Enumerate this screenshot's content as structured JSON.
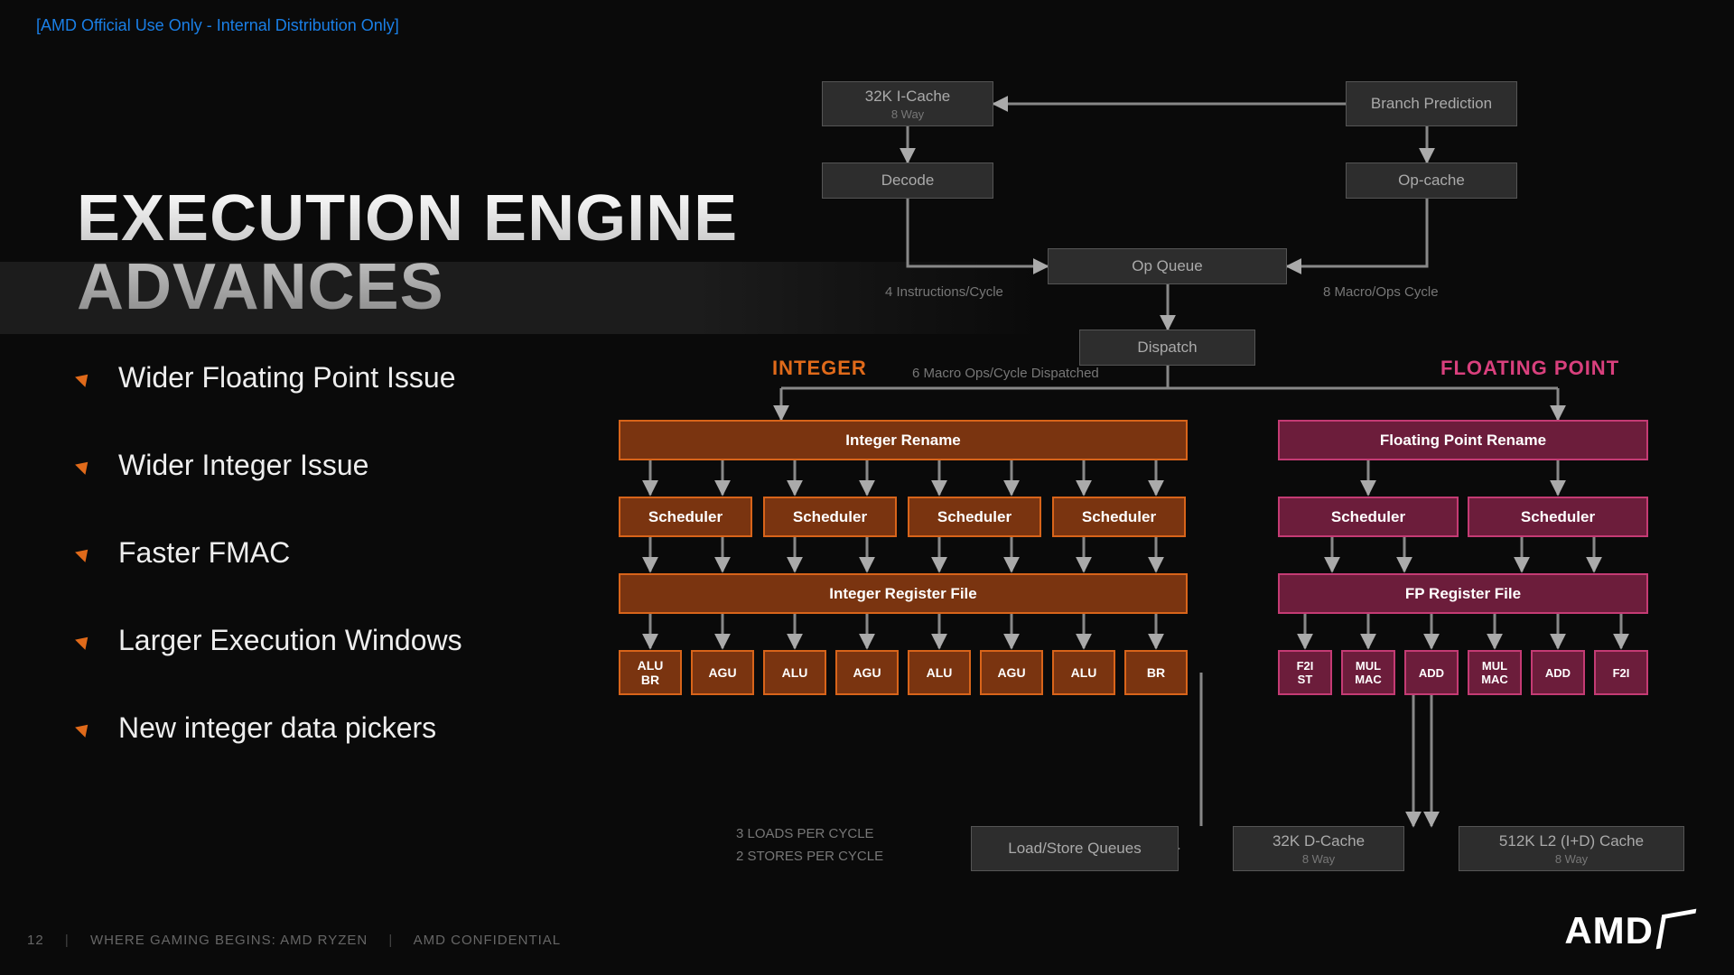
{
  "header_mark": "[AMD Official Use Only - Internal Distribution Only]",
  "title_l1": "EXECUTION ENGINE",
  "title_l2": "ADVANCES",
  "bullets": [
    "Wider Floating Point Issue",
    "Wider Integer Issue",
    "Faster FMAC",
    "Larger Execution Windows",
    "New integer data pickers"
  ],
  "footer": {
    "page": "12",
    "mid": "WHERE GAMING BEGINS:  AMD RYZEN",
    "right": "AMD CONFIDENTIAL"
  },
  "logo": "AMD",
  "labels": {
    "int": "INTEGER",
    "fp": "FLOATING POINT"
  },
  "hints": {
    "instr": "4 Instructions/Cycle",
    "macro": "8 Macro/Ops Cycle",
    "disp": "6 Macro Ops/Cycle Dispatched",
    "loads": "3 LOADS PER CYCLE",
    "stores": "2 STORES PER CYCLE"
  },
  "top": {
    "icache": {
      "t": "32K I-Cache",
      "s": "8 Way"
    },
    "branch": "Branch Prediction",
    "decode": "Decode",
    "opcache": "Op-cache",
    "opq": "Op Queue",
    "dispatch": "Dispatch"
  },
  "int": {
    "rename": "Integer Rename",
    "sched": "Scheduler",
    "regfile": "Integer Register File",
    "units": [
      "ALU\nBR",
      "AGU",
      "ALU",
      "AGU",
      "ALU",
      "AGU",
      "ALU",
      "BR"
    ]
  },
  "fp": {
    "rename": "Floating Point Rename",
    "sched": "Scheduler",
    "regfile": "FP Register File",
    "units": [
      "F2I\nST",
      "MUL\nMAC",
      "ADD",
      "MUL\nMAC",
      "ADD",
      "F2I"
    ]
  },
  "bottom": {
    "lsq": "Load/Store Queues",
    "dcache": {
      "t": "32K D-Cache",
      "s": "8 Way"
    },
    "l2": {
      "t": "512K L2 (I+D) Cache",
      "s": "8 Way"
    }
  }
}
